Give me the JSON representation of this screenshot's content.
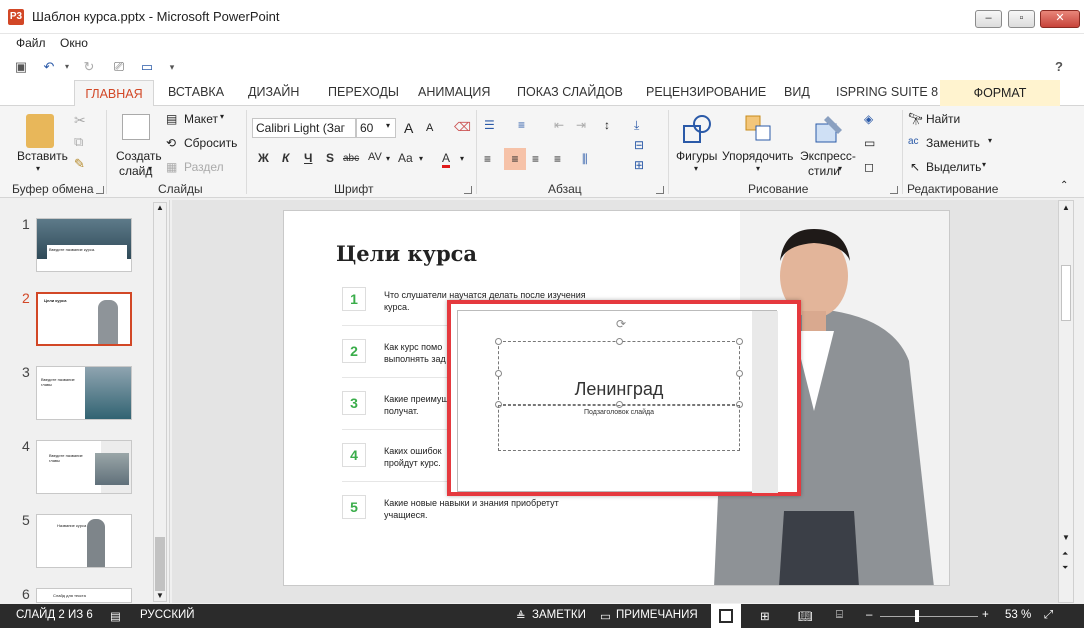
{
  "window": {
    "title": "Шаблон курса.pptx - Microsoft PowerPoint",
    "app_icon": "P3",
    "minimize": "–",
    "maximize": "▫",
    "close": "✕"
  },
  "menu": [
    "Файл",
    "Окно"
  ],
  "qat": {
    "help": "?"
  },
  "tabs": [
    "ГЛАВНАЯ",
    "ВСТАВКА",
    "ДИЗАЙН",
    "ПЕРЕХОДЫ",
    "АНИМАЦИЯ",
    "ПОКАЗ СЛАЙДОВ",
    "РЕЦЕНЗИРОВАНИЕ",
    "ВИД",
    "ISPRING SUITE 8",
    "ФОРМАТ"
  ],
  "ribbon": {
    "clipboard": {
      "paste": "Вставить",
      "label": "Буфер обмена"
    },
    "slides": {
      "new_slide_1": "Создать",
      "new_slide_2": "слайд",
      "layout": "Макет",
      "reset": "Сбросить",
      "section": "Раздел",
      "label": "Слайды"
    },
    "font": {
      "name": "Calibri Light (Заг",
      "size": "60",
      "grow": "A",
      "shrink": "A",
      "bold": "Ж",
      "italic": "К",
      "underline": "Ч",
      "shadow": "S",
      "strike": "abc",
      "spacing": "AV",
      "case": "Aa",
      "color": "A",
      "label": "Шрифт"
    },
    "paragraph": {
      "label": "Абзац"
    },
    "drawing": {
      "shapes": "Фигуры",
      "arrange": "Упорядочить",
      "quick_styles_1": "Экспресс-",
      "quick_styles_2": "стили",
      "label": "Рисование"
    },
    "editing": {
      "find": "Найти",
      "replace": "Заменить",
      "select": "Выделить",
      "label": "Редактирование"
    }
  },
  "thumbnails": [
    {
      "num": "1",
      "caption": "Введите название курса."
    },
    {
      "num": "2",
      "caption": "Цели курса"
    },
    {
      "num": "3",
      "caption": "Введите название главы"
    },
    {
      "num": "4",
      "caption": "Введите название главы"
    },
    {
      "num": "5",
      "caption": "Название курса"
    },
    {
      "num": "6",
      "caption": "Слайд для текста"
    }
  ],
  "slide": {
    "title": "Цели курса",
    "goals": [
      {
        "num": "1",
        "text": "Что слушатели научатся делать после изучения курса."
      },
      {
        "num": "2",
        "text": "Как курс помо выполнять зад"
      },
      {
        "num": "3",
        "text": "Какие преимущ получат."
      },
      {
        "num": "4",
        "text": "Каких ошибок пройдут курс."
      },
      {
        "num": "5",
        "text": "Какие новые навыки и знания приобретут учащиеся."
      }
    ]
  },
  "popup": {
    "title": "Ленинград",
    "subtitle": "Подзаголовок слайда"
  },
  "status": {
    "slide": "СЛАЙД 2 ИЗ 6",
    "lang": "РУССКИЙ",
    "notes": "ЗАМЕТКИ",
    "comments": "ПРИМЕЧАНИЯ",
    "zoom_minus": "–",
    "zoom_plus": "+",
    "zoom": "53 %",
    "zoom_fraction": 0.53
  },
  "colors": {
    "accent": "#d24726",
    "highlight": "#e5393e",
    "green": "#3aad4a"
  }
}
